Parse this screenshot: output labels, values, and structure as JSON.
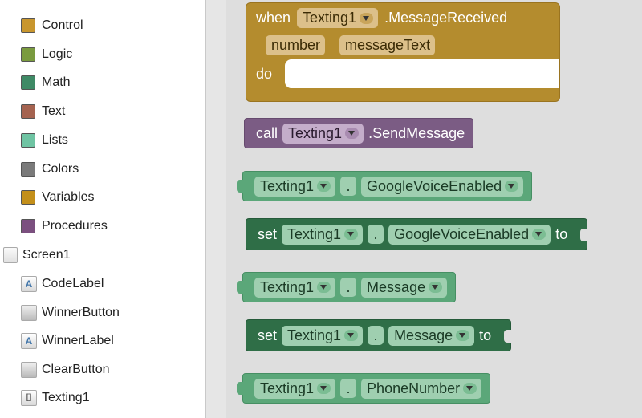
{
  "palette": {
    "categories": [
      {
        "label": "Control",
        "color": "#c8962e"
      },
      {
        "label": "Logic",
        "color": "#7a9b3f"
      },
      {
        "label": "Math",
        "color": "#3f8a66"
      },
      {
        "label": "Text",
        "color": "#a56350"
      },
      {
        "label": "Lists",
        "color": "#6fc4a3"
      },
      {
        "label": "Colors",
        "color": "#7a7a7a"
      },
      {
        "label": "Variables",
        "color": "#c38f1a"
      },
      {
        "label": "Procedures",
        "color": "#7b4f7f"
      }
    ]
  },
  "tree": {
    "screen": {
      "label": "Screen1",
      "icon": "screen-icon"
    },
    "components": [
      {
        "label": "CodeLabel",
        "icon": "label-icon"
      },
      {
        "label": "WinnerButton",
        "icon": "button-icon"
      },
      {
        "label": "WinnerLabel",
        "icon": "label-icon"
      },
      {
        "label": "ClearButton",
        "icon": "button-icon"
      },
      {
        "label": "Texting1",
        "icon": "texting-icon",
        "selected": true
      }
    ]
  },
  "blocks": {
    "event": {
      "when": "when",
      "component": "Texting1",
      "event_name": ".MessageReceived",
      "params": [
        "number",
        "messageText"
      ],
      "do": "do"
    },
    "call": {
      "keyword": "call",
      "component": "Texting1",
      "method": ".SendMessage"
    },
    "getters": [
      {
        "component": "Texting1",
        "dot": ".",
        "property": "GoogleVoiceEnabled"
      },
      {
        "component": "Texting1",
        "dot": ".",
        "property": "Message"
      },
      {
        "component": "Texting1",
        "dot": ".",
        "property": "PhoneNumber"
      }
    ],
    "setters": [
      {
        "keyword": "set",
        "component": "Texting1",
        "dot": ".",
        "property": "GoogleVoiceEnabled",
        "to": "to"
      },
      {
        "keyword": "set",
        "component": "Texting1",
        "dot": ".",
        "property": "Message",
        "to": "to"
      }
    ]
  },
  "colors": {
    "event_block": "#b48c2e",
    "call_block": "#7b5c84",
    "component_block": "#5ba779",
    "setter_block": "#2f6e47",
    "workspace_bg": "#dedede",
    "selection_bg": "#f3dcbf"
  }
}
